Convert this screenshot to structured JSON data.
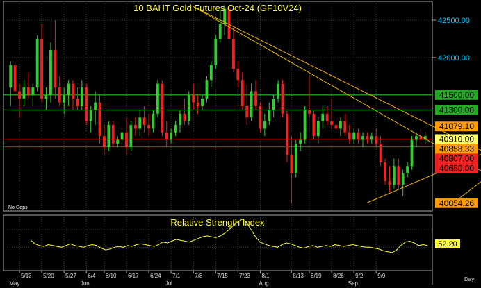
{
  "chart_data": [
    {
      "type": "candlestick",
      "title": "10  BAHT  Gold  Futures  Oct-24  (GF10V24)",
      "note": "No Gaps",
      "ylim": [
        39950,
        42750
      ],
      "y_ticks": [
        {
          "v": 42500,
          "t": "42500.00"
        },
        {
          "v": 42000,
          "t": "42000.00"
        }
      ],
      "hlines": [
        {
          "value": 41500,
          "label": "41500.00",
          "color": "#33dd33",
          "label_bg": "#22aa22",
          "label_color": "#000000"
        },
        {
          "value": 41300,
          "label": "41300.00",
          "color": "#33dd33",
          "label_bg": "#22aa22",
          "label_color": "#000000"
        },
        {
          "value": 40910,
          "label": "40910.00",
          "color": "#dd2222",
          "label_bg": "#ffff66",
          "label_color": "#000000"
        },
        {
          "value": 40807,
          "label": "40807.00",
          "color": "#dd2222",
          "label_bg": "#ee2222",
          "label_color": "#000000"
        }
      ],
      "price_labels": [
        {
          "value": 41079.1,
          "label": "41079.10",
          "bg": "#ff9900",
          "color": "#000000"
        },
        {
          "value": 40858.33,
          "label": "40858.33",
          "bg": "#ff9900",
          "color": "#000000"
        },
        {
          "value": 40650,
          "label": "40650.00",
          "bg": "#ee2222",
          "color": "#000000"
        },
        {
          "value": 40054.26,
          "label": "40054.26",
          "bg": "#ff9900",
          "color": "#000000"
        }
      ],
      "trendlines": [
        {
          "from": [
            41,
            42680
          ],
          "to": [
            119,
            40030
          ]
        },
        {
          "from": [
            41,
            42680
          ],
          "to": [
            121,
            40300
          ]
        },
        {
          "from": [
            80,
            40060
          ],
          "to": [
            121,
            41100
          ]
        },
        {
          "from": [
            100,
            40090
          ],
          "to": [
            121,
            41050
          ]
        }
      ],
      "x_ticks": [
        {
          "i": 2,
          "t": "5/13"
        },
        {
          "i": 7,
          "t": "5/20"
        },
        {
          "i": 12,
          "t": "5/27"
        },
        {
          "i": 17,
          "t": "6/4"
        },
        {
          "i": 21,
          "t": "6/10"
        },
        {
          "i": 26,
          "t": "6/17"
        },
        {
          "i": 31,
          "t": "6/24"
        },
        {
          "i": 36,
          "t": "7/1"
        },
        {
          "i": 41,
          "t": "7/8"
        },
        {
          "i": 46,
          "t": "7/15"
        },
        {
          "i": 51,
          "t": "7/23"
        },
        {
          "i": 56,
          "t": "8/1"
        },
        {
          "i": 63,
          "t": "8/13"
        },
        {
          "i": 67,
          "t": "8/19"
        },
        {
          "i": 72,
          "t": "8/26"
        },
        {
          "i": 77,
          "t": "9/2"
        },
        {
          "i": 82,
          "t": "9/9"
        }
      ],
      "month_labels": [
        {
          "i": 0,
          "t": "May"
        },
        {
          "i": 16,
          "t": "Jun"
        },
        {
          "i": 35,
          "t": "Jul"
        },
        {
          "i": 56,
          "t": "Aug"
        },
        {
          "i": 76,
          "t": "Sep"
        }
      ],
      "axis_unit_label": "Day",
      "ohlc": [
        [
          41600,
          41950,
          41350,
          41900
        ],
        [
          41900,
          42000,
          41450,
          41550
        ],
        [
          41550,
          41650,
          41200,
          41450
        ],
        [
          41450,
          41700,
          41350,
          41600
        ],
        [
          41600,
          41800,
          41450,
          41500
        ],
        [
          41500,
          41650,
          41350,
          41600
        ],
        [
          41600,
          42300,
          41550,
          42250
        ],
        [
          42250,
          42450,
          41400,
          41450
        ],
        [
          41450,
          41600,
          41300,
          41500
        ],
        [
          41500,
          42200,
          41400,
          42100
        ],
        [
          42100,
          42500,
          41450,
          41600
        ],
        [
          41600,
          41750,
          41350,
          41400
        ],
        [
          41400,
          41600,
          41250,
          41500
        ],
        [
          41500,
          41700,
          41350,
          41650
        ],
        [
          41650,
          41700,
          41300,
          41450
        ],
        [
          41450,
          41600,
          41300,
          41350
        ],
        [
          41350,
          41700,
          41300,
          41600
        ],
        [
          41600,
          41650,
          41100,
          41150
        ],
        [
          41150,
          41350,
          41000,
          41300
        ],
        [
          41300,
          41550,
          41100,
          41400
        ],
        [
          41400,
          41500,
          40850,
          40950
        ],
        [
          40950,
          41100,
          40700,
          40800
        ],
        [
          40800,
          41150,
          40750,
          41100
        ],
        [
          41100,
          41150,
          40800,
          40850
        ],
        [
          40850,
          40950,
          40800,
          40900
        ],
        [
          40900,
          41050,
          40850,
          41000
        ],
        [
          41000,
          41200,
          40700,
          40800
        ],
        [
          40800,
          41150,
          40750,
          41100
        ],
        [
          41100,
          41200,
          40950,
          41050
        ],
        [
          41050,
          41300,
          40950,
          41200
        ],
        [
          41200,
          41350,
          41000,
          41100
        ],
        [
          41100,
          41250,
          40950,
          41050
        ],
        [
          41050,
          41300,
          41000,
          41250
        ],
        [
          41250,
          41700,
          41200,
          41650
        ],
        [
          41650,
          41700,
          40950,
          41000
        ],
        [
          41000,
          41150,
          40800,
          40900
        ],
        [
          40900,
          41050,
          40850,
          41000
        ],
        [
          41000,
          41150,
          40950,
          41100
        ],
        [
          41100,
          41300,
          41000,
          41250
        ],
        [
          41250,
          41450,
          41100,
          41150
        ],
        [
          41150,
          41550,
          41100,
          41500
        ],
        [
          41500,
          41650,
          41300,
          41400
        ],
        [
          41400,
          41500,
          41250,
          41350
        ],
        [
          41350,
          41500,
          41300,
          41450
        ],
        [
          41450,
          41750,
          41400,
          41700
        ],
        [
          41700,
          41950,
          41600,
          41900
        ],
        [
          41900,
          42300,
          41850,
          42250
        ],
        [
          42250,
          42650,
          42200,
          42450
        ],
        [
          42450,
          42700,
          42300,
          42650
        ],
        [
          42650,
          42700,
          42200,
          42250
        ],
        [
          42250,
          42400,
          41800,
          41850
        ],
        [
          41850,
          41950,
          41600,
          41700
        ],
        [
          41700,
          41800,
          41300,
          41350
        ],
        [
          41350,
          41650,
          41100,
          41200
        ],
        [
          41200,
          41650,
          41150,
          41550
        ],
        [
          41550,
          41700,
          41300,
          41350
        ],
        [
          41350,
          41400,
          41000,
          41050
        ],
        [
          41050,
          41250,
          40950,
          41150
        ],
        [
          41150,
          41400,
          41100,
          41300
        ],
        [
          41300,
          41500,
          41200,
          41450
        ],
        [
          41450,
          41700,
          41400,
          41650
        ],
        [
          41650,
          41700,
          41200,
          41250
        ],
        [
          41250,
          41300,
          40600,
          40700
        ],
        [
          40700,
          40950,
          40050,
          40450
        ],
        [
          40450,
          40900,
          40400,
          40850
        ],
        [
          40850,
          41000,
          40750,
          40900
        ],
        [
          40900,
          41350,
          40850,
          41300
        ],
        [
          41300,
          41750,
          41200,
          41250
        ],
        [
          41250,
          41300,
          40900,
          40950
        ],
        [
          40950,
          41200,
          40850,
          41150
        ],
        [
          41150,
          41350,
          41050,
          41250
        ],
        [
          41250,
          41350,
          41100,
          41150
        ],
        [
          41150,
          41450,
          41050,
          41100
        ],
        [
          41100,
          41200,
          41000,
          41050
        ],
        [
          41050,
          41200,
          40950,
          41150
        ],
        [
          41150,
          41250,
          40950,
          41000
        ],
        [
          41000,
          41100,
          40850,
          40900
        ],
        [
          40900,
          41050,
          40850,
          41000
        ],
        [
          41000,
          41050,
          40850,
          40900
        ],
        [
          40900,
          41000,
          40800,
          40950
        ],
        [
          40950,
          41000,
          40850,
          40900
        ],
        [
          40900,
          41000,
          40850,
          40950
        ],
        [
          40950,
          41050,
          40800,
          40850
        ],
        [
          40850,
          40950,
          40550,
          40600
        ],
        [
          40600,
          40650,
          40300,
          40350
        ],
        [
          40350,
          40550,
          40200,
          40300
        ],
        [
          40300,
          40650,
          40250,
          40550
        ],
        [
          40550,
          40650,
          40250,
          40300
        ],
        [
          40300,
          40500,
          40150,
          40450
        ],
        [
          40450,
          40600,
          40400,
          40550
        ],
        [
          40550,
          40950,
          40500,
          40900
        ],
        [
          40900,
          41000,
          40800,
          40950
        ],
        [
          40950,
          41050,
          40850,
          40900
        ],
        [
          40900,
          41000,
          40850,
          40950
        ]
      ]
    },
    {
      "type": "line",
      "title": "Relative Strength Index",
      "last_value": 52.2,
      "last_label": "52.20",
      "ylim": [
        25,
        85
      ],
      "values": [
        58,
        54,
        52,
        51,
        53,
        52,
        51,
        50,
        52,
        54,
        52,
        51,
        50,
        52,
        53,
        52,
        49,
        47,
        48,
        50,
        51,
        50,
        52,
        51,
        53,
        54,
        53,
        52,
        51,
        53,
        56,
        55,
        57,
        59,
        58,
        57,
        56,
        58,
        60,
        62,
        63,
        62,
        61,
        63,
        66,
        70,
        75,
        79,
        82,
        78,
        70,
        62,
        56,
        54,
        52,
        51,
        50,
        53,
        55,
        54,
        52,
        50,
        49,
        51,
        52,
        50,
        51,
        52,
        51,
        53,
        52,
        51,
        52,
        53,
        52,
        51,
        50,
        50,
        49,
        48,
        46,
        45,
        44,
        47,
        52,
        56,
        57,
        55,
        52,
        53,
        52
      ]
    }
  ]
}
